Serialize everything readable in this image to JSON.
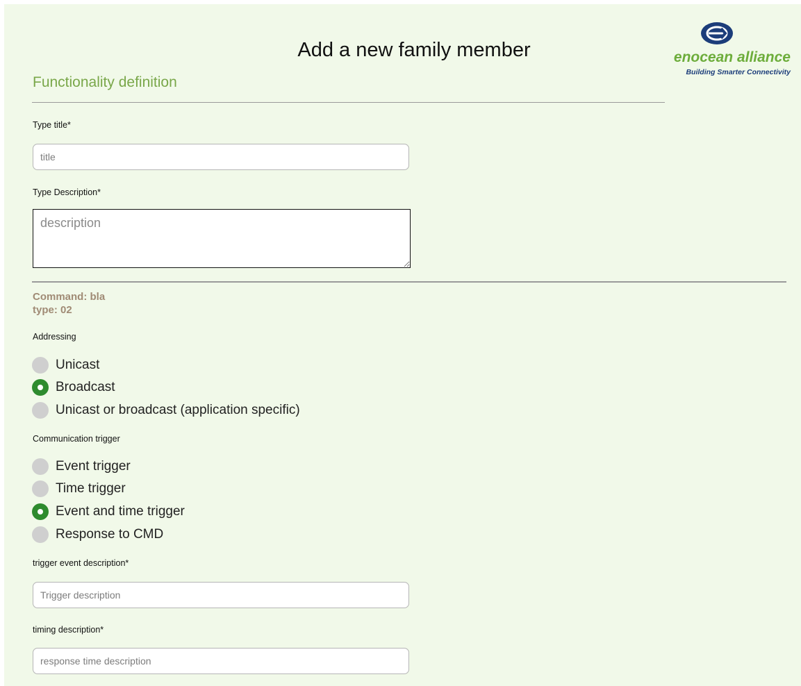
{
  "header": {
    "title": "Add a new family member",
    "logo": {
      "name": "enocean alliance",
      "tagline": "Building Smarter Connectivity",
      "icon": "enocean-emblem-icon",
      "colors": {
        "name": "#6dad3b",
        "tagline": "#1c3d7a",
        "emblem": "#1c3d7a"
      }
    }
  },
  "functionality": {
    "heading": "Functionality definition",
    "type_title": {
      "label": "Type title*",
      "placeholder": "title",
      "value": ""
    },
    "type_description": {
      "label": "Type Description*",
      "placeholder": "description",
      "value": ""
    }
  },
  "command": {
    "name_line": "Command: bla",
    "type_line": "type: 02"
  },
  "addressing": {
    "label": "Addressing",
    "options": [
      {
        "label": "Unicast",
        "checked": false
      },
      {
        "label": "Broadcast",
        "checked": true
      },
      {
        "label": "Unicast or broadcast (application specific)",
        "checked": false
      }
    ]
  },
  "communication_trigger": {
    "label": "Communication trigger",
    "options": [
      {
        "label": "Event trigger",
        "checked": false
      },
      {
        "label": "Time trigger",
        "checked": false
      },
      {
        "label": "Event and time trigger",
        "checked": true
      },
      {
        "label": "Response to CMD",
        "checked": false
      }
    ]
  },
  "trigger_event": {
    "label": "trigger event description*",
    "placeholder": "Trigger description",
    "value": ""
  },
  "timing": {
    "label": "timing description*",
    "placeholder": "response time description",
    "value": ""
  },
  "colors": {
    "page_background": "#f1f9e9",
    "section_heading": "#79a749",
    "command_text": "#a08b75",
    "radio_checked": "#2e8b2e",
    "radio_unchecked": "#cfcfcf"
  }
}
